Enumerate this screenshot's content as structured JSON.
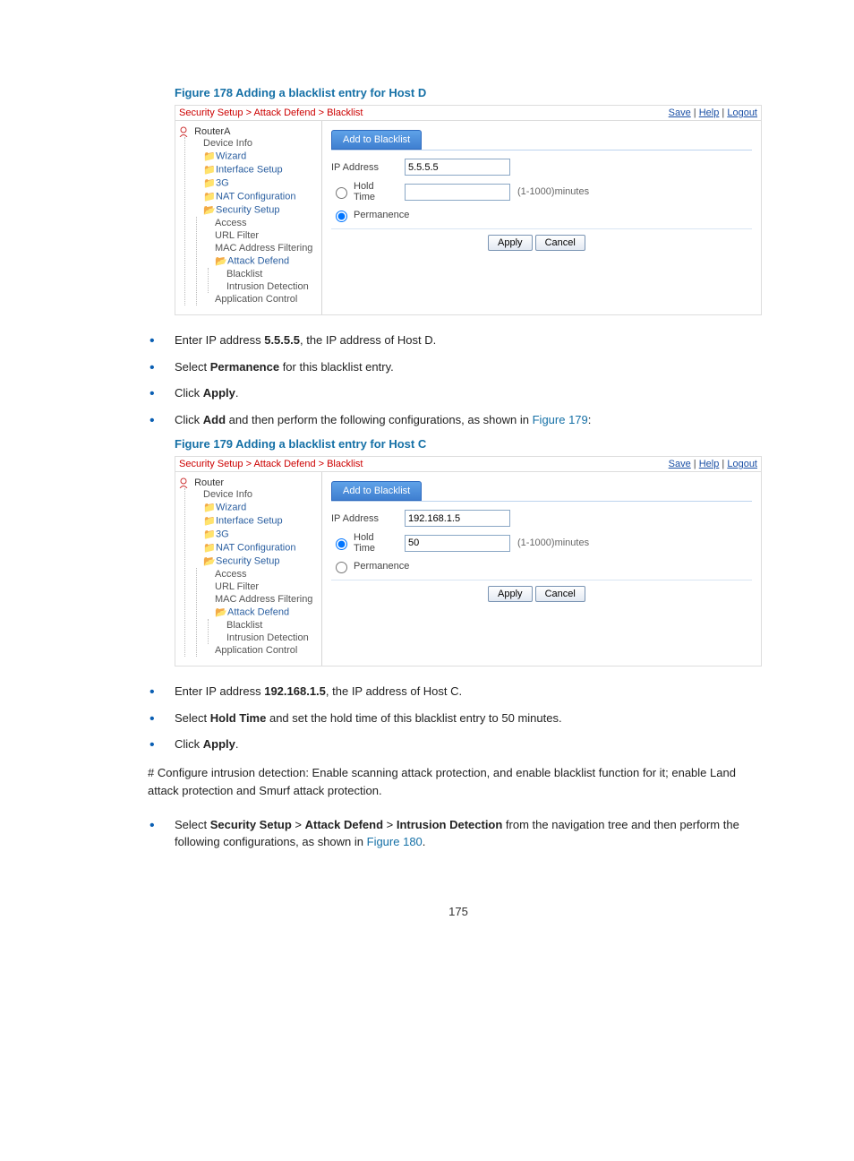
{
  "figure178": {
    "title": "Figure 178 Adding a blacklist entry for Host D",
    "breadcrumb": "Security Setup > Attack Defend > Blacklist",
    "links": {
      "save": "Save",
      "help": "Help",
      "logout": "Logout"
    },
    "root": "RouterA",
    "nav": {
      "device_info": "Device Info",
      "wizard": "Wizard",
      "interface_setup": "Interface Setup",
      "g3": "3G",
      "nat": "NAT Configuration",
      "security": "Security Setup",
      "access": "Access",
      "url": "URL Filter",
      "mac": "MAC Address Filtering",
      "attack": "Attack Defend",
      "blacklist": "Blacklist",
      "intrusion": "Intrusion Detection",
      "appctl": "Application Control"
    },
    "tab": "Add to Blacklist",
    "ip_label": "IP Address",
    "ip_value": "5.5.5.5",
    "hold_label": "Hold Time",
    "hold_value": "",
    "hint": "(1-1000)minutes",
    "perm_label": "Permanence",
    "selected": "permanence",
    "apply": "Apply",
    "cancel": "Cancel"
  },
  "steps1": {
    "s1a": "Enter IP address ",
    "s1b": "5.5.5.5",
    "s1c": ", the IP address of Host D.",
    "s2a": "Select ",
    "s2b": "Permanence",
    "s2c": " for this blacklist entry.",
    "s3a": "Click ",
    "s3b": "Apply",
    "s3c": ".",
    "s4a": "Click ",
    "s4b": "Add",
    "s4c": " and then perform the following configurations, as shown in ",
    "s4ref": "Figure 179",
    "s4d": ":"
  },
  "figure179": {
    "title": "Figure 179 Adding a blacklist entry for Host C",
    "breadcrumb": "Security Setup > Attack Defend > Blacklist",
    "links": {
      "save": "Save",
      "help": "Help",
      "logout": "Logout"
    },
    "root": "Router",
    "nav": {
      "device_info": "Device Info",
      "wizard": "Wizard",
      "interface_setup": "Interface Setup",
      "g3": "3G",
      "nat": "NAT Configuration",
      "security": "Security Setup",
      "access": "Access",
      "url": "URL Filter",
      "mac": "MAC Address Filtering",
      "attack": "Attack Defend",
      "blacklist": "Blacklist",
      "intrusion": "Intrusion Detection",
      "appctl": "Application Control"
    },
    "tab": "Add to Blacklist",
    "ip_label": "IP Address",
    "ip_value": "192.168.1.5",
    "hold_label": "Hold Time",
    "hold_value": "50",
    "hint": "(1-1000)minutes",
    "perm_label": "Permanence",
    "selected": "hold",
    "apply": "Apply",
    "cancel": "Cancel"
  },
  "steps2": {
    "s1a": "Enter IP address ",
    "s1b": "192.168.1.5",
    "s1c": ", the IP address of Host C.",
    "s2a": "Select ",
    "s2b": "Hold Time",
    "s2c": " and set the hold time of this blacklist entry to 50 minutes.",
    "s3a": "Click ",
    "s3b": "Apply",
    "s3c": "."
  },
  "para1": "# Configure intrusion detection: Enable scanning attack protection, and enable blacklist function for it; enable Land attack protection and Smurf attack protection.",
  "steps3": {
    "s1a": "Select ",
    "s1b": "Security Setup",
    "s1c": " > ",
    "s1d": "Attack Defend",
    "s1e": " > ",
    "s1f": "Intrusion Detection",
    "s1g": " from the navigation tree and then perform the following configurations, as shown in ",
    "s1ref": "Figure 180",
    "s1h": "."
  },
  "pagenum": "175"
}
